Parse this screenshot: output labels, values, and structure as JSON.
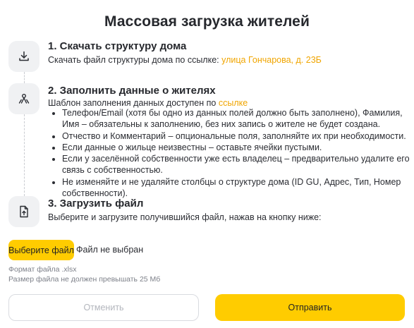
{
  "page_title": "Массовая загрузка жителей",
  "step1": {
    "title": "1. Скачать структуру дома",
    "text": "Скачать файл структуры дома по ссылке: ",
    "link": "улица Гончарова, д. 23Б",
    "icon": "download-icon"
  },
  "step2": {
    "title": "2. Заполнить данные о жителях",
    "text": "Шаблон заполнения данных доступен по ",
    "link": "ссылке",
    "icon": "people-icon",
    "rules": [
      "Телефон/Email (хотя бы одно из данных полей должно быть заполнено), Фамилия, Имя – обязательны к заполнению, без них запись о жителе не будет создана.",
      "Отчество и Комментарий – опциональные поля, заполняйте их при необходимости.",
      "Если данные о жильце неизвестны – оставьте ячейки пустыми.",
      "Если у заселённой собственности уже есть владелец – предварительно удалите его связь с собственностью.",
      "Не изменяйте и не удаляйте столбцы о структуре дома (ID GU, Адрес, Тип, Номер собственности)."
    ]
  },
  "step3": {
    "title": "3. Загрузить файл",
    "text": "Выберите и загрузите получившийся файл, нажав на кнопку ниже:",
    "icon": "file-upload-icon"
  },
  "file_input": {
    "button_label": "Выберите файл",
    "status": "Файл не выбран"
  },
  "hints": {
    "format": "Формат файла .xlsx",
    "size": "Размер файла не должен превышать 25 Мб"
  },
  "actions": {
    "cancel": "Отменить",
    "submit": "Отправить"
  },
  "colors": {
    "accent": "#ffcc00",
    "link": "#f0a500",
    "icon_bg": "#f0f1f3"
  }
}
